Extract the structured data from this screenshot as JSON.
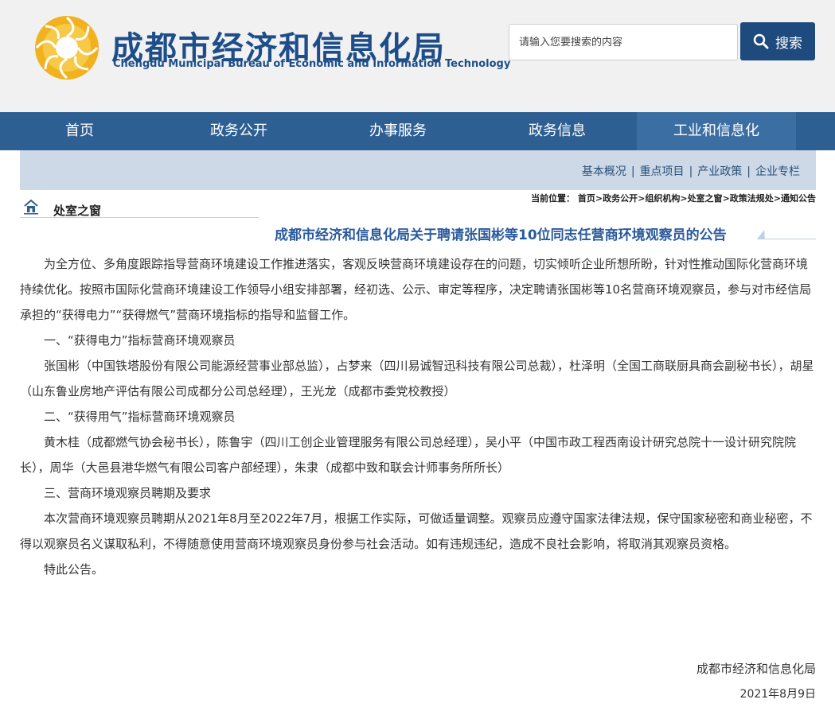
{
  "header": {
    "title_cn": "成都市经济和信息化局",
    "title_en": "Chengdu Municipal Bureau of Economic and Information Technology",
    "search_placeholder": "请输入您要搜索的内容",
    "search_button": "搜索",
    "colors": {
      "brand": "#1d4e89",
      "nav": "#2e5f93",
      "logo": "#f2b21f"
    }
  },
  "nav": {
    "items": [
      {
        "label": "首页"
      },
      {
        "label": "政务公开"
      },
      {
        "label": "办事服务"
      },
      {
        "label": "政务信息"
      },
      {
        "label": "工业和信息化"
      }
    ]
  },
  "subnav": {
    "items": [
      {
        "label": "基本概况"
      },
      {
        "label": "重点项目"
      },
      {
        "label": "产业政策"
      },
      {
        "label": "企业专栏"
      }
    ]
  },
  "section": {
    "title": "处室之窗",
    "icon": "home-icon"
  },
  "breadcrumb": {
    "prefix": "当前位置：",
    "items": [
      "首页",
      "政务公开",
      "组织机构",
      "处室之窗",
      "政策法规处",
      "通知公告"
    ],
    "sep": ">"
  },
  "article": {
    "title": "成都市经济和信息化局关于聘请张国彬等10位同志任营商环境观察员的公告",
    "paragraphs": [
      "为全方位、多角度跟踪指导营商环境建设工作推进落实，客观反映营商环境建设存在的问题，切实倾听企业所想所盼，针对性推动国际化营商环境持续优化。按照市国际化营商环境建设工作领导小组安排部署，经初选、公示、审定等程序，决定聘请张国彬等10名营商环境观察员，参与对市经信局承担的“获得电力”“获得燃气”营商环境指标的指导和监督工作。",
      "一、“获得电力”指标营商环境观察员",
      "张国彬（中国铁塔股份有限公司能源经营事业部总监），占梦来（四川易诚智迅科技有限公司总裁），杜泽明（全国工商联厨具商会副秘书长），胡星（山东鲁业房地产评估有限公司成都分公司总经理），王光龙（成都市委党校教授）",
      "二、“获得用气”指标营商环境观察员",
      "黄木桂（成都燃气协会秘书长），陈鲁宇（四川工创企业管理服务有限公司总经理），吴小平（中国市政工程西南设计研究总院十一设计研究院院长），周华（大邑县港华燃气有限公司客户部经理），朱隶（成都中致和联会计师事务所所长）",
      "三、营商环境观察员聘期及要求",
      "本次营商环境观察员聘期从2021年8月至2022年7月，根据工作实际，可做适量调整。观察员应遵守国家法律法规，保守国家秘密和商业秘密，不得以观察员名义谋取私利，不得随意使用营商环境观察员身份参与社会活动。如有违规违纪，造成不良社会影响，将取消其观察员资格。",
      "特此公告。"
    ],
    "signature": "成都市经济和信息化局",
    "date": "2021年8月9日"
  }
}
